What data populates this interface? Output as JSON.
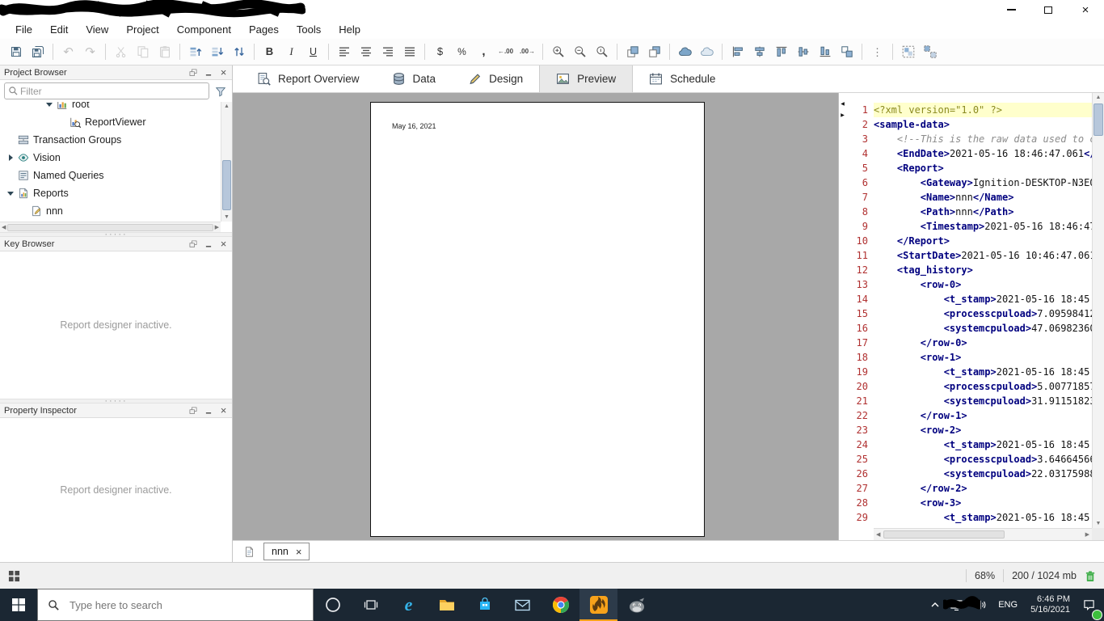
{
  "titlebar": {
    "redacted": true
  },
  "menu": {
    "items": [
      "File",
      "Edit",
      "View",
      "Project",
      "Component",
      "Pages",
      "Tools",
      "Help"
    ]
  },
  "toolbar": {
    "groups": [
      {
        "icons": [
          {
            "name": "save"
          },
          {
            "name": "save-all"
          }
        ]
      },
      {
        "icons": [
          {
            "name": "undo",
            "disabled": true
          },
          {
            "name": "redo",
            "disabled": true
          }
        ]
      },
      {
        "icons": [
          {
            "name": "cut",
            "disabled": true
          },
          {
            "name": "copy",
            "disabled": true
          },
          {
            "name": "paste",
            "disabled": true
          }
        ]
      },
      {
        "icons": [
          {
            "name": "move-up"
          },
          {
            "name": "move-down"
          },
          {
            "name": "swap"
          }
        ]
      },
      {
        "icons": [
          {
            "name": "bold"
          },
          {
            "name": "italic"
          },
          {
            "name": "underline"
          }
        ]
      },
      {
        "icons": [
          {
            "name": "align-left"
          },
          {
            "name": "align-center"
          },
          {
            "name": "align-right"
          },
          {
            "name": "align-justify"
          }
        ]
      },
      {
        "icons": [
          {
            "name": "currency"
          },
          {
            "name": "percent"
          },
          {
            "name": "comma"
          },
          {
            "name": "increase-decimal"
          },
          {
            "name": "decrease-decimal"
          }
        ]
      },
      {
        "icons": [
          {
            "name": "zoom-in"
          },
          {
            "name": "zoom-out"
          },
          {
            "name": "zoom-actual"
          }
        ]
      },
      {
        "icons": [
          {
            "name": "bring-to-front"
          },
          {
            "name": "send-to-back"
          }
        ]
      },
      {
        "icons": [
          {
            "name": "shape-union"
          },
          {
            "name": "shape-subtract"
          }
        ]
      },
      {
        "icons": [
          {
            "name": "align-left-edges"
          },
          {
            "name": "align-center-horizontal"
          },
          {
            "name": "align-top-edges"
          },
          {
            "name": "align-center-vertical"
          },
          {
            "name": "align-bottom-edges"
          },
          {
            "name": "match-size"
          }
        ]
      },
      {
        "icons": [
          {
            "name": "more"
          }
        ]
      },
      {
        "icons": [
          {
            "name": "group"
          },
          {
            "name": "ungroup"
          }
        ]
      }
    ]
  },
  "project_browser": {
    "title": "Project Browser",
    "filter_placeholder": "Filter",
    "tree": [
      {
        "label": "root",
        "icon": "chart",
        "level": 3,
        "expander": "down"
      },
      {
        "label": "ReportViewer",
        "icon": "chart-viewer",
        "level": 4
      },
      {
        "label": "Transaction Groups",
        "icon": "transaction-groups",
        "level": 0
      },
      {
        "label": "Vision",
        "icon": "eye",
        "level": 0,
        "expander": "right"
      },
      {
        "label": "Named Queries",
        "icon": "named-query",
        "level": 0
      },
      {
        "label": "Reports",
        "icon": "report",
        "level": 0,
        "expander": "down"
      },
      {
        "label": "nnn",
        "icon": "report-edit",
        "level": 1
      }
    ]
  },
  "key_browser": {
    "title": "Key Browser",
    "empty_message": "Report designer inactive."
  },
  "property_inspector": {
    "title": "Property Inspector",
    "empty_message": "Report designer inactive."
  },
  "report_tabs": [
    {
      "label": "Report Overview",
      "icon": "report-overview",
      "active": false
    },
    {
      "label": "Data",
      "icon": "data",
      "active": false
    },
    {
      "label": "Design",
      "icon": "design",
      "active": false
    },
    {
      "label": "Preview",
      "icon": "preview",
      "active": true
    },
    {
      "label": "Schedule",
      "icon": "schedule",
      "active": false
    }
  ],
  "preview": {
    "page_text": "May 16, 2021"
  },
  "code": {
    "lines": [
      "<?xml version=\"1.0\" ?>",
      "<sample-data>",
      "    <!--This is the raw data used to c",
      "    <EndDate>2021-05-16 18:46:47.061</",
      "    <Report>",
      "        <Gateway>Ignition-DESKTOP-N3EO",
      "        <Name>nnn</Name>",
      "        <Path>nnn</Path>",
      "        <Timestamp>2021-05-16 18:46:47",
      "    </Report>",
      "    <StartDate>2021-05-16 10:46:47.061",
      "    <tag_history>",
      "        <row-0>",
      "            <t_stamp>2021-05-16 18:45:",
      "            <processcpuload>7.09598412",
      "            <systemcpuload>47.06982360",
      "        </row-0>",
      "        <row-1>",
      "            <t_stamp>2021-05-16 18:45:",
      "            <processcpuload>5.00771857",
      "            <systemcpuload>31.91151823",
      "        </row-1>",
      "        <row-2>",
      "            <t_stamp>2021-05-16 18:45:",
      "            <processcpuload>3.64664566",
      "            <systemcpuload>22.03175988",
      "        </row-2>",
      "        <row-3>",
      "            <t_stamp>2021-05-16 18:45:"
    ]
  },
  "doc_tabs": [
    {
      "label": "nnn",
      "closable": true
    }
  ],
  "statusbar": {
    "zoom": "68%",
    "memory": "200 / 1024 mb"
  },
  "taskbar": {
    "search_placeholder": "Type here to search",
    "apps": [
      "cortana",
      "task-view",
      "edge",
      "file-explorer",
      "store",
      "mail",
      "chrome",
      "ignition",
      "gimp"
    ],
    "active_app": "ignition",
    "tray": {
      "language": "ENG",
      "time": "6:46 PM",
      "date": "5/16/2021"
    }
  },
  "colors": {
    "accent_orange": "#f7a21b",
    "taskbar": "#1b2733",
    "xml_tag": "#00007f",
    "line_number": "#b03030",
    "decl_highlight": "#ffffcc"
  }
}
